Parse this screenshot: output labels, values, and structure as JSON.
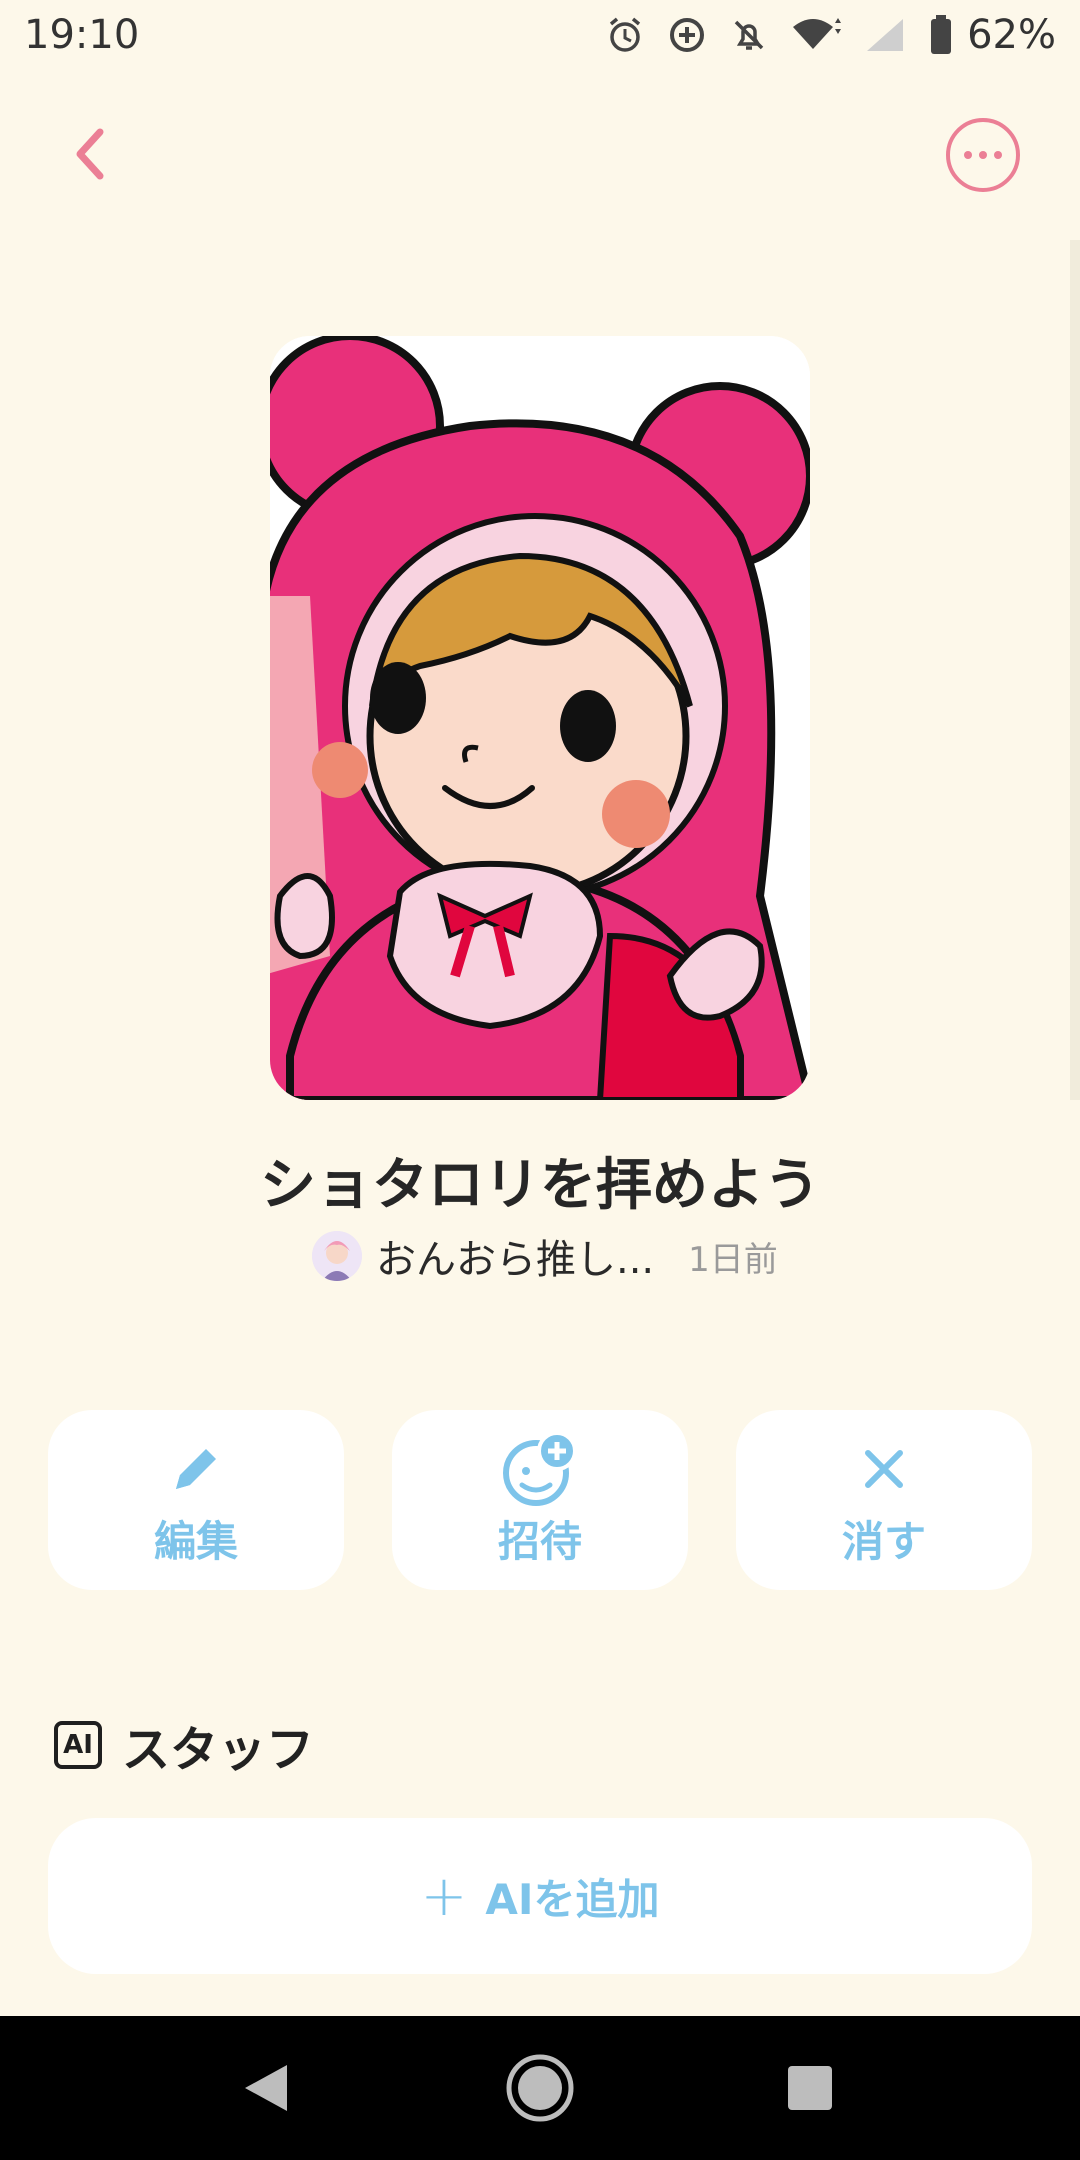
{
  "status_bar": {
    "time": "19:10",
    "battery": "62%",
    "icons": [
      "alarm-icon",
      "data-saver-icon",
      "notifications-off-icon",
      "wifi-icon",
      "signal-icon",
      "battery-icon"
    ]
  },
  "header": {
    "back_icon": "chevron-left-icon",
    "more_icon": "more-horizontal-icon"
  },
  "room": {
    "title": "ショタロリを拝めよう",
    "owner_name": "おんおら推し...",
    "updated": "1日前"
  },
  "actions": [
    {
      "label": "編集",
      "icon": "pencil-icon"
    },
    {
      "label": "招待",
      "icon": "invite-face-icon"
    },
    {
      "label": "消す",
      "icon": "close-icon"
    }
  ],
  "staff": {
    "badge": "AI",
    "title": "スタッフ",
    "add_plus": "+",
    "add_label": "AIを追加"
  },
  "colors": {
    "background": "#FDF8EA",
    "accent_pink": "#EB7F95",
    "accent_blue": "#7EC4EA",
    "character_pink": "#E8307A"
  }
}
